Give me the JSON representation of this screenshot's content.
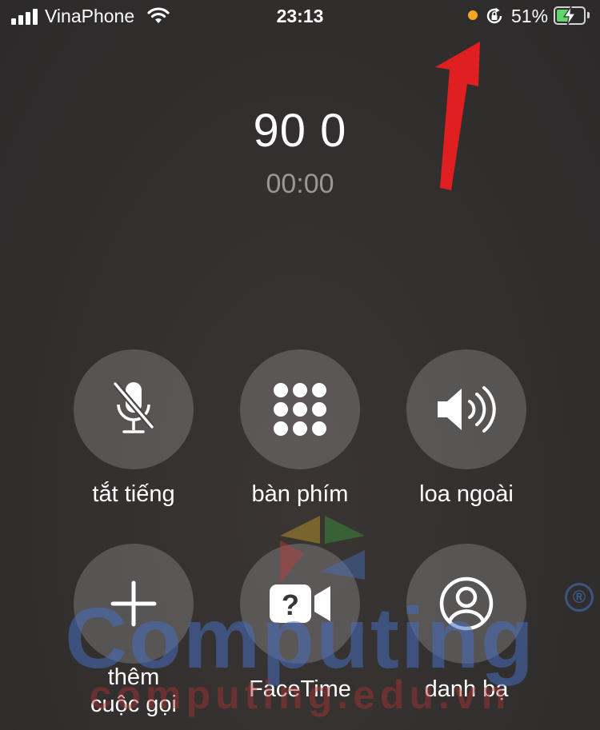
{
  "status_bar": {
    "carrier": "VinaPhone",
    "time": "23:13",
    "battery_percent": "51%",
    "battery_level": 0.51,
    "charging": true,
    "indicator_color": "#f5a623"
  },
  "call": {
    "number": "90 0",
    "duration": "00:00"
  },
  "controls": [
    {
      "id": "mute",
      "label": "tắt tiếng",
      "icon": "mic-slash-icon"
    },
    {
      "id": "keypad",
      "label": "bàn phím",
      "icon": "keypad-icon"
    },
    {
      "id": "speaker",
      "label": "loa ngoài",
      "icon": "speaker-icon"
    },
    {
      "id": "add-call",
      "label": "thêm\ncuộc gọi",
      "icon": "plus-icon"
    },
    {
      "id": "facetime",
      "label": "FaceTime",
      "icon": "facetime-unavailable-icon"
    },
    {
      "id": "contacts",
      "label": "danh bạ",
      "icon": "contact-icon"
    }
  ],
  "watermark": {
    "brand": "Computing",
    "site": "computing.edu.vn",
    "registered": "®"
  },
  "annotation_color": "#e02020"
}
